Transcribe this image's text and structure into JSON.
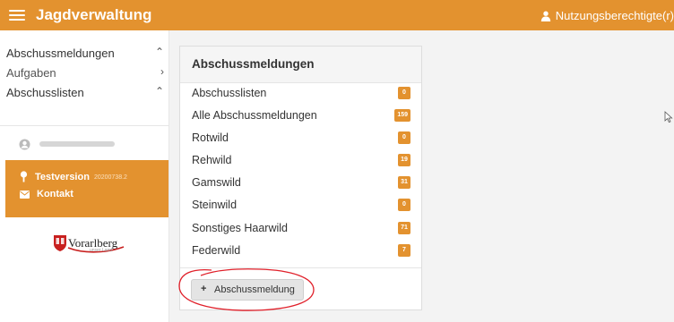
{
  "header": {
    "app_title": "Jagdverwaltung",
    "user_label": "Nutzungsberechtigte(r)",
    "color": "#e3922f"
  },
  "sidebar": {
    "items": [
      {
        "label": "Abschussmeldungen",
        "chevron": "^"
      },
      {
        "label": "Aufgaben",
        "chevron": "›"
      },
      {
        "label": "Abschusslisten",
        "chevron": "^"
      }
    ],
    "panel": {
      "version_label": "Testversion",
      "version_number": "20200738.2",
      "contact_label": "Kontakt"
    },
    "logo_text": "Vorarlberg",
    "logo_subtext": "unser Land"
  },
  "card": {
    "title": "Abschussmeldungen",
    "rows": [
      {
        "label": "Abschusslisten",
        "count": "0"
      },
      {
        "label": "Alle Abschussmeldungen",
        "count": "159"
      },
      {
        "label": "Rotwild",
        "count": "0"
      },
      {
        "label": "Rehwild",
        "count": "19"
      },
      {
        "label": "Gamswild",
        "count": "31"
      },
      {
        "label": "Steinwild",
        "count": "0"
      },
      {
        "label": "Sonstiges Haarwild",
        "count": "71"
      },
      {
        "label": "Federwild",
        "count": "7"
      }
    ],
    "add_button_label": "Abschussmeldung",
    "badge_color": "#e3922f"
  },
  "annotation_color": "#e0202a"
}
